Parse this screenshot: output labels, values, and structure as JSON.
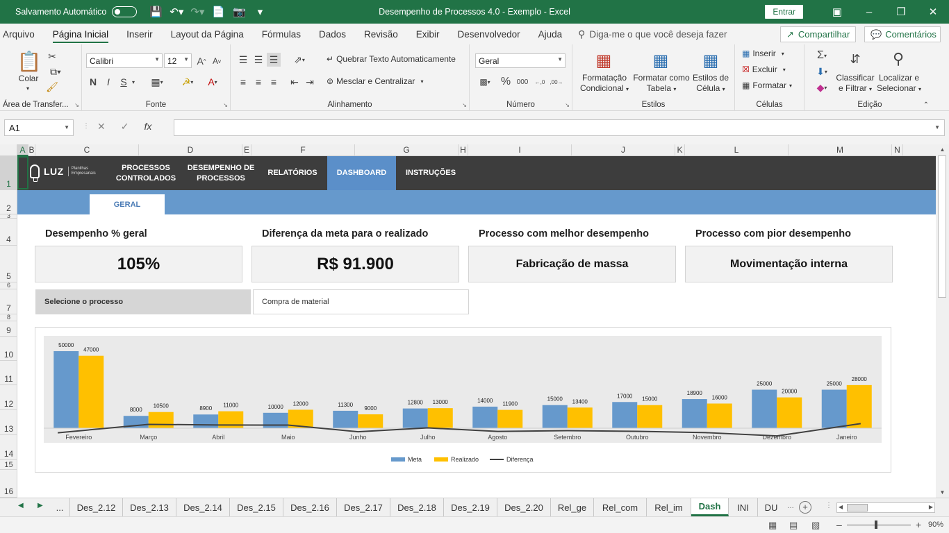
{
  "titlebar": {
    "autosave_label": "Salvamento Automático",
    "window_title": "Desempenho de Processos 4.0 - Exemplo  -  Excel",
    "signin_label": "Entrar"
  },
  "menu": {
    "items": [
      "Arquivo",
      "Página Inicial",
      "Inserir",
      "Layout da Página",
      "Fórmulas",
      "Dados",
      "Revisão",
      "Exibir",
      "Desenvolvedor",
      "Ajuda"
    ],
    "search_placeholder": "Diga-me o que você deseja fazer",
    "share_label": "Compartilhar",
    "comments_label": "Comentários"
  },
  "ribbon": {
    "clipboard": {
      "paste": "Colar",
      "group": "Área de Transfer..."
    },
    "font": {
      "name": "Calibri",
      "size": "12",
      "group": "Fonte",
      "bold": "N",
      "italic": "I",
      "underline": "S"
    },
    "alignment": {
      "wrap": "Quebrar Texto Automaticamente",
      "merge": "Mesclar e Centralizar",
      "group": "Alinhamento"
    },
    "number": {
      "format": "Geral",
      "group": "Número"
    },
    "styles": {
      "conditional": "Formatação Condicional",
      "table": "Formatar como Tabela",
      "cell_styles": "Estilos de Célula",
      "group": "Estilos"
    },
    "cells": {
      "insert": "Inserir",
      "delete": "Excluir",
      "format": "Formatar",
      "group": "Células"
    },
    "editing": {
      "sort": "Classificar e Filtrar",
      "find": "Localizar e Selecionar",
      "group": "Edição"
    }
  },
  "formula_bar": {
    "name_box": "A1",
    "formula": ""
  },
  "columns": [
    "A",
    "B",
    "C",
    "D",
    "E",
    "F",
    "G",
    "H",
    "I",
    "J",
    "K",
    "L",
    "M",
    "N"
  ],
  "rows": [
    "1",
    "2",
    "3",
    "4",
    "5",
    "6",
    "7",
    "8",
    "9",
    "10",
    "11",
    "12",
    "13",
    "14",
    "15",
    "16"
  ],
  "dashboard": {
    "logo_text": "LUZ",
    "logo_sub": "Planilhas Empresariais",
    "nav": [
      "PROCESSOS CONTROLADOS",
      "DESEMPENHO DE PROCESSOS",
      "RELATÓRIOS",
      "DASHBOARD",
      "INSTRUÇÕES"
    ],
    "active_nav": "DASHBOARD",
    "subtab": "GERAL",
    "kpis": [
      {
        "title": "Desempenho % geral",
        "value": "105%"
      },
      {
        "title": "Diferença da meta para o realizado",
        "value": "R$ 91.900"
      },
      {
        "title": "Processo com melhor desempenho",
        "value": "Fabricação de massa"
      },
      {
        "title": "Processo com pior desempenho",
        "value": "Movimentação interna"
      }
    ],
    "selector_label": "Selecione o processo",
    "selector_value": "Compra de material"
  },
  "chart_data": {
    "type": "bar",
    "categories": [
      "Fevereiro",
      "Março",
      "Abril",
      "Maio",
      "Junho",
      "Julho",
      "Agosto",
      "Setembro",
      "Outubro",
      "Novembro",
      "Dezembro",
      "Janeiro"
    ],
    "series": [
      {
        "name": "Meta",
        "values": [
          50000,
          8000,
          8900,
          10000,
          11300,
          12800,
          14000,
          15000,
          17000,
          18900,
          25000,
          25000
        ],
        "color": "#6699cc"
      },
      {
        "name": "Realizado",
        "values": [
          47000,
          10500,
          11000,
          12000,
          9000,
          13000,
          11900,
          13400,
          15000,
          16000,
          20000,
          28000
        ],
        "color": "#ffc000"
      },
      {
        "name": "Diferença",
        "type": "line",
        "values": [
          -3000,
          2500,
          2100,
          2000,
          -2300,
          200,
          -2100,
          -1600,
          -2000,
          -2900,
          -5000,
          3000
        ],
        "color": "#404040"
      }
    ],
    "legend": "bottom",
    "grid": false
  },
  "sheet_tabs": [
    "...",
    "Des_2.12",
    "Des_2.13",
    "Des_2.14",
    "Des_2.15",
    "Des_2.16",
    "Des_2.17",
    "Des_2.18",
    "Des_2.19",
    "Des_2.20",
    "Rel_ge",
    "Rel_com",
    "Rel_im",
    "Dash",
    "INI",
    "DU"
  ],
  "active_tab": "Dash",
  "status": {
    "zoom": "90%"
  }
}
